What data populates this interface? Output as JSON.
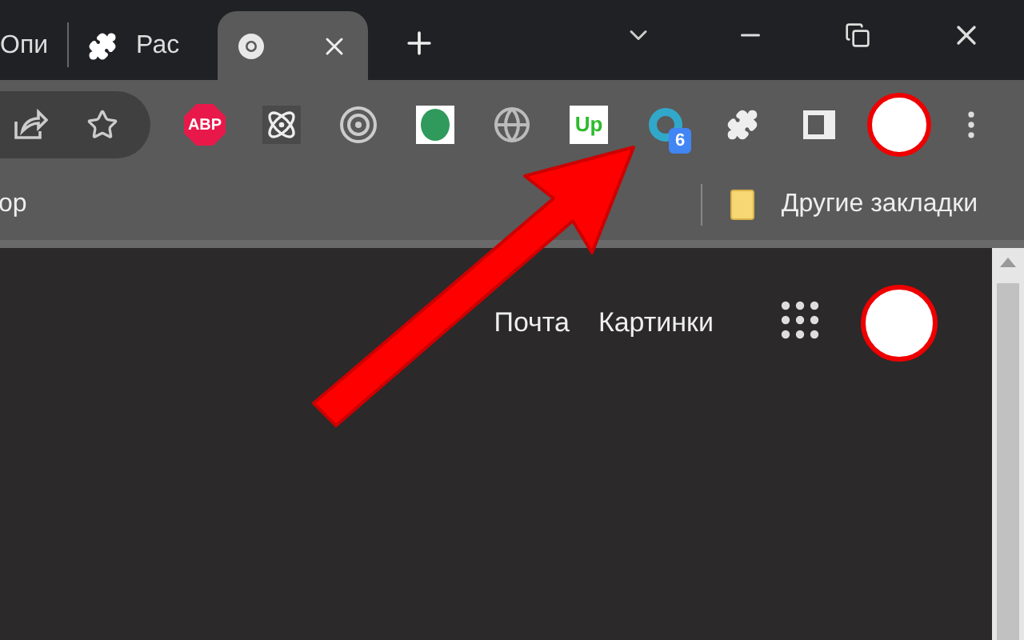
{
  "tabs": [
    {
      "kind": "page",
      "title": "Опи",
      "selected": false
    },
    {
      "kind": "extensions",
      "title": "Рас",
      "selected": false
    },
    {
      "kind": "chrome",
      "selected": true
    }
  ],
  "extensions": [
    {
      "kind": "abp",
      "text": "ABP"
    },
    {
      "kind": "atom"
    },
    {
      "kind": "target"
    },
    {
      "kind": "green"
    },
    {
      "kind": "globe"
    },
    {
      "kind": "up",
      "text": "Up"
    },
    {
      "kind": "badge",
      "badge": "6"
    }
  ],
  "bookmarks": {
    "cut_item": "ор",
    "other": "Другие закладки"
  },
  "page_links": [
    "Почта",
    "Картинки"
  ]
}
